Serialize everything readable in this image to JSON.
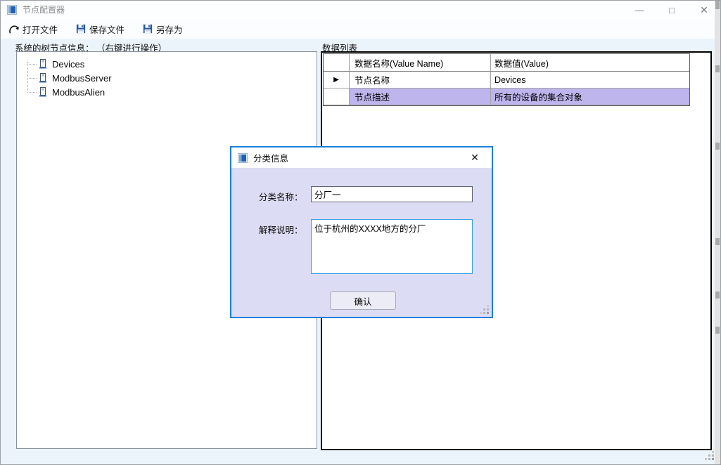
{
  "window": {
    "title": "节点配置器",
    "controls": {
      "minimize": "—",
      "maximize": "□",
      "close": "✕"
    }
  },
  "toolbar": {
    "open_label": "打开文件",
    "save_label": "保存文件",
    "save_as_label": "另存为"
  },
  "left_panel": {
    "label": "系统的树节点信息： （右键进行操作）",
    "tree_items": [
      {
        "label": "Devices"
      },
      {
        "label": "ModbusServer"
      },
      {
        "label": "ModbusAlien"
      }
    ]
  },
  "right_panel": {
    "label": "数据列表",
    "grid": {
      "columns": [
        {
          "header": "数据名称(Value Name)"
        },
        {
          "header": "数据值(Value)"
        }
      ],
      "rows": [
        {
          "marker": "▶",
          "name": "节点名称",
          "value": "Devices",
          "highlighted": false
        },
        {
          "marker": "",
          "name": "节点描述",
          "value": "所有的设备的集合对象",
          "highlighted": true
        }
      ]
    }
  },
  "dialog": {
    "title": "分类信息",
    "close": "✕",
    "name_field": {
      "label": "分类名称：",
      "value": "分厂一"
    },
    "desc_field": {
      "label": "解释说明：",
      "value": "位于杭州的XXXX地方的分厂"
    },
    "confirm_label": "确认"
  },
  "colors": {
    "dialog_border": "#1c80da",
    "dialog_body": "#dcdcf4",
    "highlight_row": "#bdb5ec",
    "save_icon_blue": "#2456a8",
    "window_bg": "#ecf4fb"
  }
}
